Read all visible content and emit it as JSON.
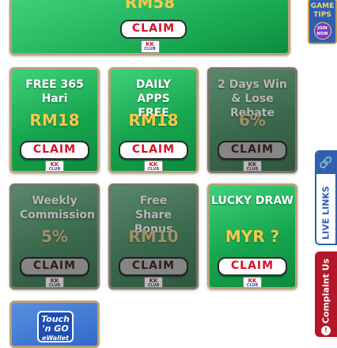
{
  "banner": {
    "amount": "RM58",
    "claim": "CLAIM",
    "logo_top": "KK",
    "logo_bottom": "CLUB"
  },
  "cards": [
    {
      "title": "FREE 365 Hari",
      "amount": "RM18",
      "claim": "CLAIM"
    },
    {
      "title": "DAILY APPS FREE",
      "amount": "RM18",
      "claim": "CLAIM"
    },
    {
      "title": "2 Days Win & Lose Rebate",
      "amount": "6%",
      "claim": "CLAIM"
    },
    {
      "title": "Weekly Commission",
      "amount": "5%",
      "claim": "CLAIM"
    },
    {
      "title": "Free Share Bonus",
      "amount": "RM10",
      "claim": "CLAIM"
    },
    {
      "title": "LUCKY DRAW",
      "amount": "MYR ?",
      "claim": "CLAIM"
    }
  ],
  "logo": {
    "top": "KK",
    "bottom": "CLUB"
  },
  "game_tips": {
    "line1": "GAME",
    "line2": "TIPS",
    "button": "JOIN NOW"
  },
  "side": {
    "live_links": "LIVE LINKS",
    "complaint": "Complaint Us"
  },
  "tng": {
    "line1": "Touch",
    "line2": "'n GO",
    "line3": "eWallet"
  },
  "icons": {
    "link": "link-icon",
    "complaint": "warning-icon"
  }
}
